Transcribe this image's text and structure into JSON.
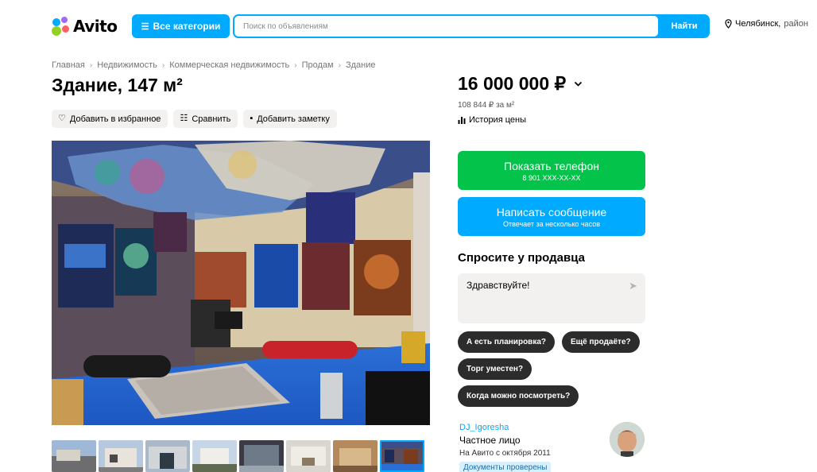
{
  "header": {
    "logo_text": "Avito",
    "logo_colors": [
      "#00aaff",
      "#97cf26",
      "#ff6163",
      "#a169f7"
    ],
    "categories_label": "Все категории",
    "search_placeholder": "Поиск по объявлениям",
    "search_button": "Найти",
    "location_city": "Челябинск,",
    "location_area": "район"
  },
  "breadcrumbs": [
    "Главная",
    "Недвижимость",
    "Коммерческая недвижимость",
    "Продам",
    "Здание"
  ],
  "listing": {
    "title": "Здание, 147 м²",
    "actions": {
      "favorite": "Добавить в избранное",
      "compare": "Сравнить",
      "note": "Добавить заметку"
    },
    "thumbnail_count": 8,
    "active_thumbnail": 8
  },
  "price": {
    "value": "16 000 000 ₽",
    "per_m2": "108 844 ₽ за м²",
    "history_label": "История цены"
  },
  "contact": {
    "phone_label": "Показать телефон",
    "phone_masked": "8 901 XXX-XX-XX",
    "message_label": "Написать сообщение",
    "message_sub": "Отвечает за несколько часов"
  },
  "ask": {
    "title": "Спросите у продавца",
    "message_value": "Здравствуйте!",
    "quick_questions": [
      "А есть планировка?",
      "Ещё продаёте?",
      "Торг уместен?",
      "Когда можно посмотреть?"
    ]
  },
  "seller": {
    "name": "DJ_Igoresha",
    "type": "Частное лицо",
    "since": "На Авито с октября 2011",
    "badge": "Документы проверены"
  },
  "colors": {
    "accent_blue": "#00aaff",
    "green": "#04c34a",
    "chip_dark": "#2c2c2c"
  }
}
